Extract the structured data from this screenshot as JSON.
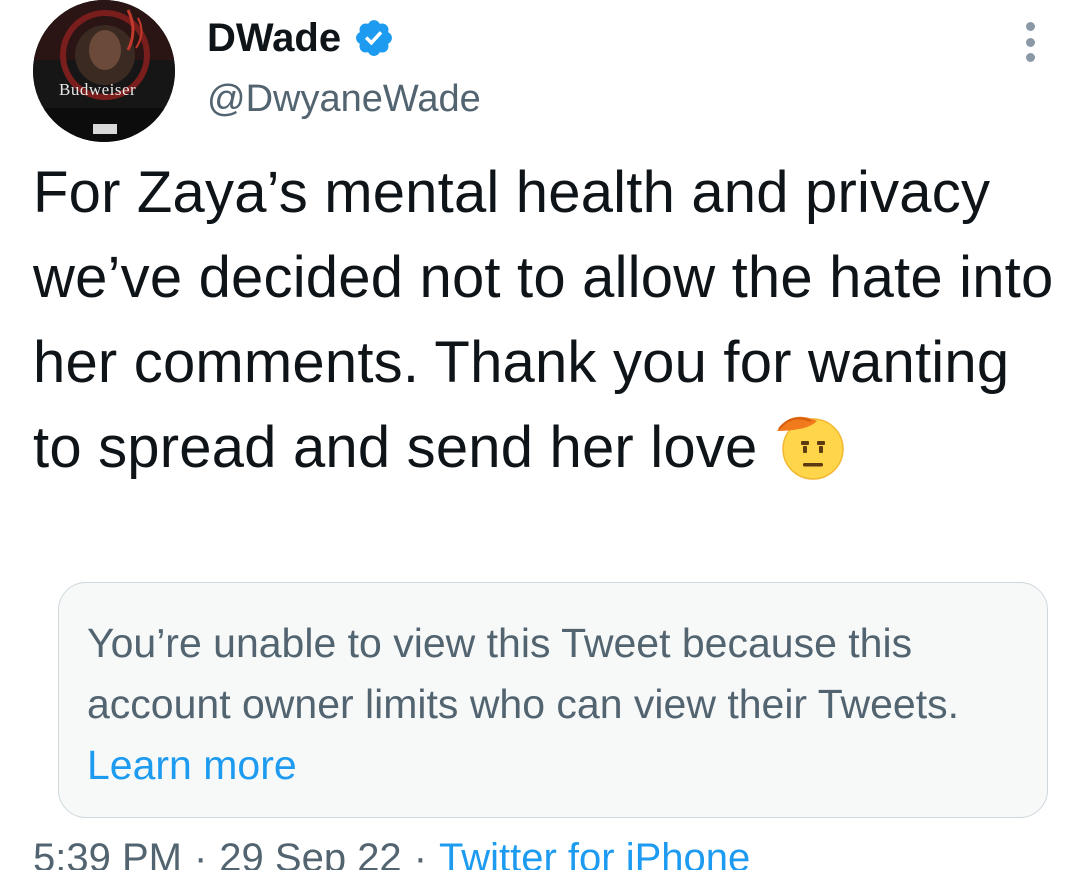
{
  "author": {
    "display_name": "DWade",
    "handle": "@DwyaneWade",
    "verified": true,
    "avatar_text": "Budweiser"
  },
  "tweet": {
    "text": "For Zaya’s mental health and privacy we’ve decided not to allow the hate into her comments. Thank you for wanting to spread and send her love",
    "emoji": "saluting-face"
  },
  "quoted_notice": {
    "message": "You’re unable to view this Tweet because this account owner limits who can view their Tweets. ",
    "link_label": "Learn more"
  },
  "meta": {
    "time": "5:39 PM",
    "separator": "·",
    "date": "29 Sep 22",
    "source": "Twitter for iPhone"
  },
  "colors": {
    "text_primary": "#0f1419",
    "text_secondary": "#536471",
    "link": "#1d9bf0",
    "verified_badge": "#1d9bf0",
    "notice_bg": "#f7f9f9",
    "notice_border": "#cfd9de"
  },
  "icons": {
    "verified": "verified-badge-icon",
    "more": "more-dots-icon",
    "emoji": "saluting-face-emoji"
  }
}
